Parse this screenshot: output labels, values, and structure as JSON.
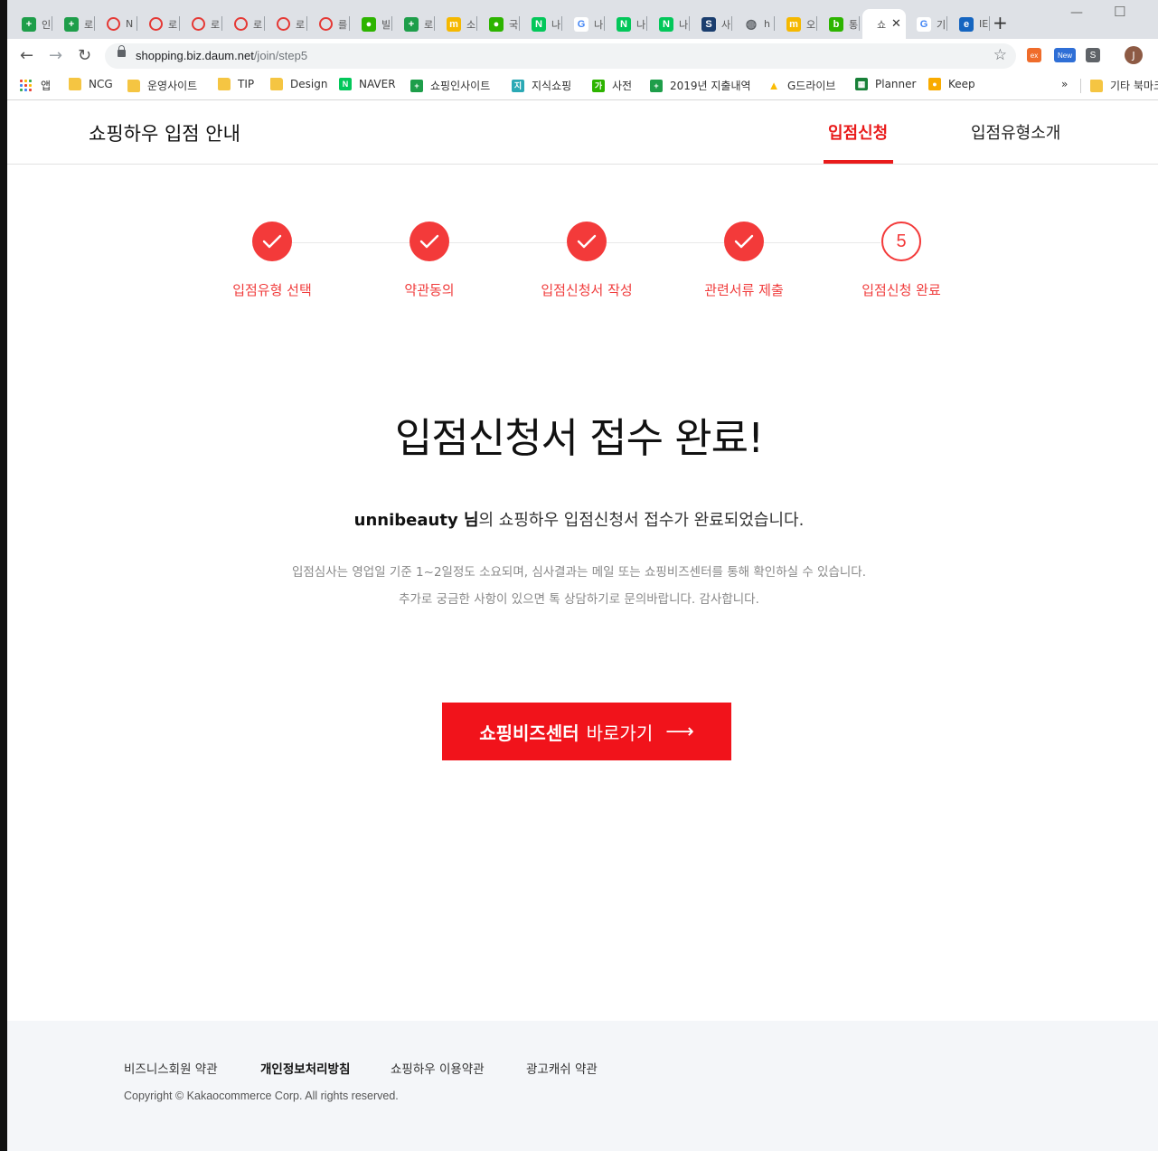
{
  "browser": {
    "tabs": [
      {
        "icon": "green-plus-icon",
        "color": "#1e9e4a",
        "glyph": "+",
        "title": "인"
      },
      {
        "icon": "green-plus-icon",
        "color": "#1e9e4a",
        "glyph": "+",
        "title": "로"
      },
      {
        "icon": "red-circle-icon",
        "color": "#e53935",
        "glyph": "O",
        "title": "N"
      },
      {
        "icon": "red-circle-icon",
        "color": "#e53935",
        "glyph": "O",
        "title": "로"
      },
      {
        "icon": "red-circle-icon",
        "color": "#e53935",
        "glyph": "O",
        "title": "로"
      },
      {
        "icon": "red-circle-icon",
        "color": "#e53935",
        "glyph": "O",
        "title": "로"
      },
      {
        "icon": "red-circle-icon",
        "color": "#e53935",
        "glyph": "O",
        "title": "로"
      },
      {
        "icon": "red-circle-icon",
        "color": "#e53935",
        "glyph": "O",
        "title": "를"
      },
      {
        "icon": "green-talk-icon",
        "color": "#2db400",
        "glyph": "●",
        "title": "빌"
      },
      {
        "icon": "green-plus-icon",
        "color": "#1e9e4a",
        "glyph": "+",
        "title": "로"
      },
      {
        "icon": "yellow-m-icon",
        "color": "#f5b800",
        "glyph": "m",
        "title": "소"
      },
      {
        "icon": "green-talk-icon",
        "color": "#2db400",
        "glyph": "●",
        "title": "국"
      },
      {
        "icon": "naver-icon",
        "color": "#03c75a",
        "glyph": "N",
        "title": "나"
      },
      {
        "icon": "google-icon",
        "color": "#ffffff",
        "glyph": "G",
        "title": "나"
      },
      {
        "icon": "naver-icon",
        "color": "#03c75a",
        "glyph": "N",
        "title": "나"
      },
      {
        "icon": "naver-icon",
        "color": "#03c75a",
        "glyph": "N",
        "title": "나"
      },
      {
        "icon": "s-icon",
        "color": "#1a3d6e",
        "glyph": "S",
        "title": "사"
      },
      {
        "icon": "globe-icon",
        "color": "#5f6368",
        "glyph": "◍",
        "title": "h"
      },
      {
        "icon": "yellow-m-icon",
        "color": "#f5b800",
        "glyph": "m",
        "title": "오"
      },
      {
        "icon": "blog-icon",
        "color": "#2db400",
        "glyph": "b",
        "title": "통"
      },
      {
        "icon": "active",
        "color": "#ffffff",
        "glyph": "",
        "title": "쇼"
      },
      {
        "icon": "google-icon",
        "color": "#ffffff",
        "glyph": "G",
        "title": "기"
      },
      {
        "icon": "ie-icon",
        "color": "#1565c0",
        "glyph": "e",
        "title": "IE"
      }
    ],
    "url_host": "shopping.biz.daum.net",
    "url_path": "/join/step5",
    "extensions": [
      "ex",
      "New",
      "S"
    ],
    "avatar_initial": "J",
    "bookmarks": [
      {
        "label": "앱",
        "type": "apps"
      },
      {
        "label": "NCG",
        "type": "folder"
      },
      {
        "label": "운영사이트",
        "type": "folder"
      },
      {
        "label": "TIP",
        "type": "folder"
      },
      {
        "label": "Design",
        "type": "folder"
      },
      {
        "label": "NAVER",
        "type": "naver",
        "color": "#03c75a",
        "glyph": "N"
      },
      {
        "label": "쇼핑인사이트",
        "type": "site",
        "color": "#1e9e4a",
        "glyph": "+"
      },
      {
        "label": "지식쇼핑",
        "type": "site",
        "color": "#2ba9b5",
        "glyph": "지"
      },
      {
        "label": "사전",
        "type": "site",
        "color": "#2db400",
        "glyph": "가"
      },
      {
        "label": "2019년 지출내역",
        "type": "site",
        "color": "#1e9e4a",
        "glyph": "+"
      },
      {
        "label": "G드라이브",
        "type": "drive",
        "color": "#fbbc04",
        "glyph": "▲"
      },
      {
        "label": "Planner",
        "type": "site",
        "color": "#188038",
        "glyph": "▦"
      },
      {
        "label": "Keep",
        "type": "site",
        "color": "#f9ab00",
        "glyph": "●"
      },
      {
        "label": "기타 북마크",
        "type": "folder"
      }
    ],
    "bookmarks_overflow": "»"
  },
  "site": {
    "title": "쇼핑하우 입점 안내",
    "nav": [
      {
        "label": "입점신청",
        "active": true
      },
      {
        "label": "입점유형소개",
        "active": false
      }
    ]
  },
  "steps": [
    {
      "label": "입점유형 선택",
      "state": "done"
    },
    {
      "label": "약관동의",
      "state": "done"
    },
    {
      "label": "입점신청서 작성",
      "state": "done"
    },
    {
      "label": "관련서류 제출",
      "state": "done"
    },
    {
      "label": "입점신청 완료",
      "state": "current",
      "number": "5"
    }
  ],
  "main": {
    "headline": "입점신청서 접수 완료!",
    "user_name": "unnibeauty 님",
    "message_suffix": "의 쇼핑하우 입점신청서 접수가 완료되었습니다.",
    "notice_lines": [
      "입점심사는 영업일 기준 1~2일정도 소요되며, 심사결과는 메일 또는 쇼핑비즈센터를 통해 확인하실 수 있습니다.",
      "추가로 궁금한 사항이 있으면 톡 상담하기로 문의바랍니다. 감사합니다."
    ],
    "cta_bold": "쇼핑비즈센터",
    "cta_rest": "바로가기",
    "cta_arrow": "⟶"
  },
  "footer": {
    "links": [
      {
        "label": "비즈니스회원 약관",
        "bold": false
      },
      {
        "label": "개인정보처리방침",
        "bold": true
      },
      {
        "label": "쇼핑하우 이용약관",
        "bold": false
      },
      {
        "label": "광고캐쉬 약관",
        "bold": false
      }
    ],
    "copyright": "Copyright © Kakaocommerce Corp. All rights reserved."
  },
  "colors": {
    "accent": "#f33a3a",
    "cta": "#f1131b",
    "nav_active": "#e91b1b",
    "footer_bg": "#f4f6f9"
  }
}
